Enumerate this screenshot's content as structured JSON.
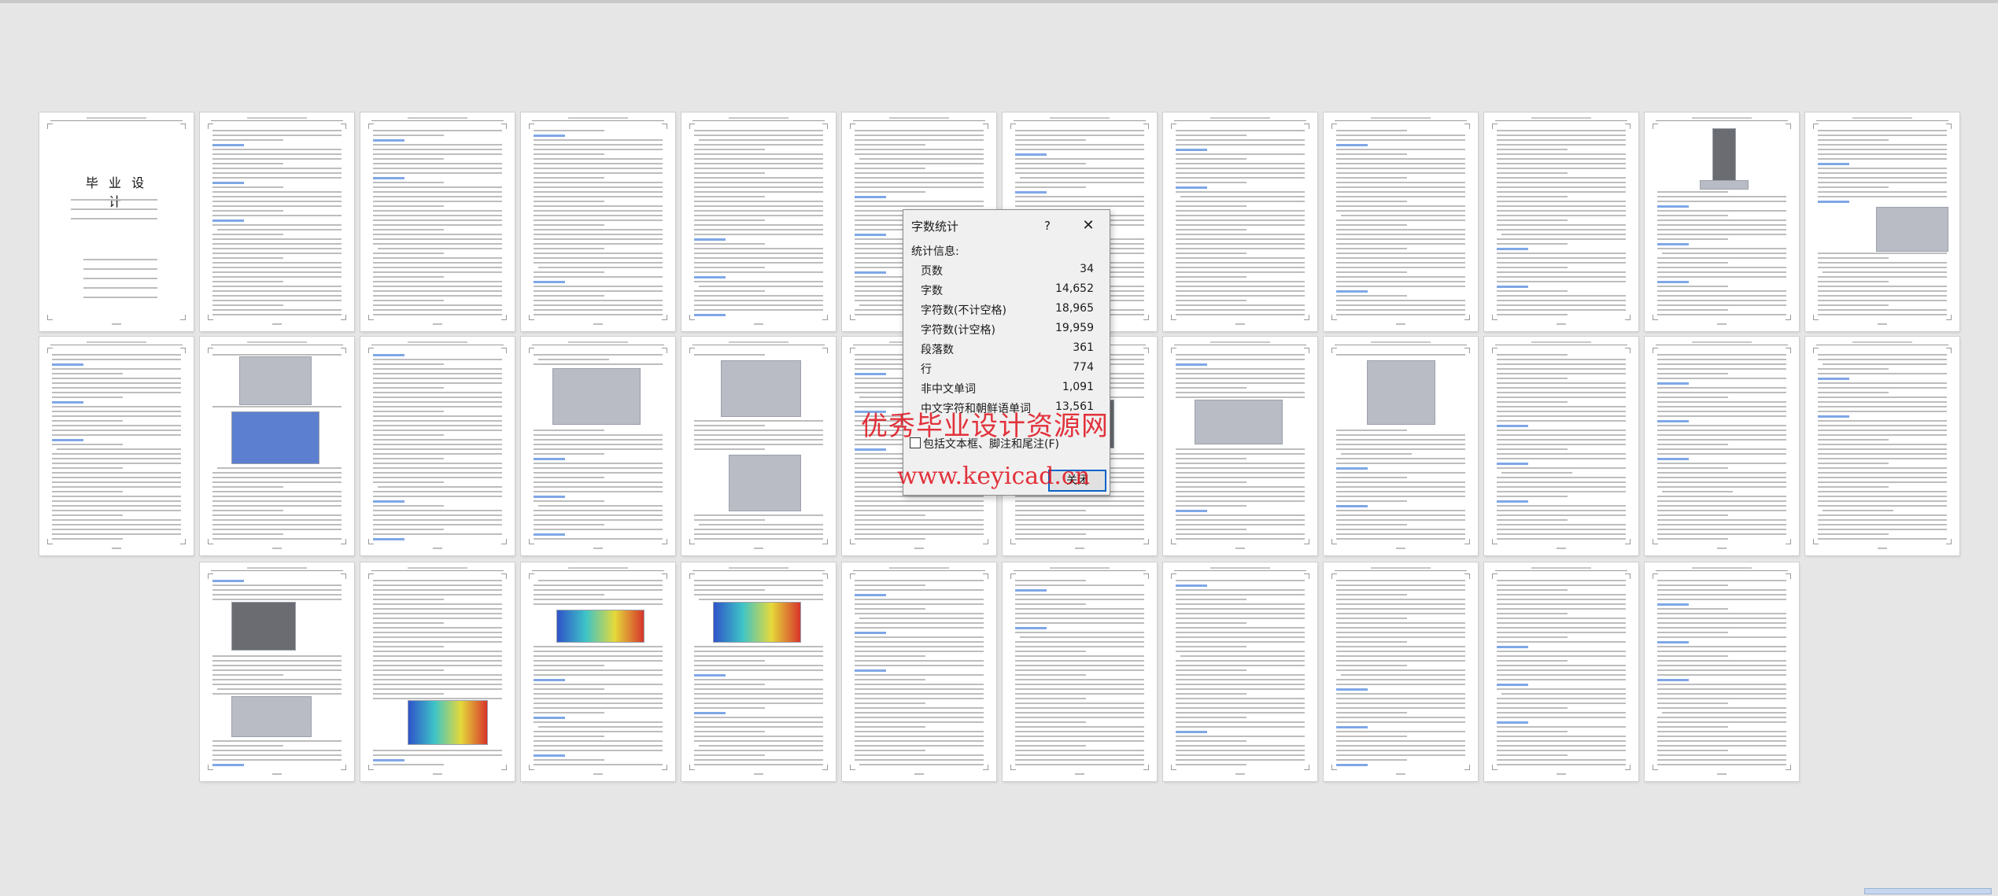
{
  "dialog": {
    "title": "字数统计",
    "help_label": "?",
    "close_glyph": "✕",
    "section_label": "统计信息:",
    "stats": [
      {
        "label": "页数",
        "value": "34"
      },
      {
        "label": "字数",
        "value": "14,652"
      },
      {
        "label": "字符数(不计空格)",
        "value": "18,965"
      },
      {
        "label": "字符数(计空格)",
        "value": "19,959"
      },
      {
        "label": "段落数",
        "value": "361"
      },
      {
        "label": "行",
        "value": "774"
      },
      {
        "label": "非中文单词",
        "value": "1,091"
      },
      {
        "label": "中文字符和朝鲜语单词",
        "value": "13,561"
      }
    ],
    "checkbox_label": "包括文本框、脚注和尾注(F)",
    "checkbox_checked": false,
    "close_button_label": "关闭"
  },
  "document": {
    "cover_title": "毕 业 设 计",
    "page_count_visible": 34
  },
  "watermark": {
    "line1": "优秀毕业设计资源网",
    "line2": "www.keyicad.cn",
    "color": "#e0121c"
  },
  "icons": {
    "close": "close-icon",
    "help": "help-icon",
    "checkbox": "checkbox-icon"
  }
}
